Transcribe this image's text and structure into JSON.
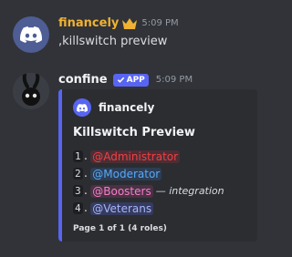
{
  "messages": [
    {
      "author": "financely",
      "author_color": "#f0b232",
      "badge_icon": "crown-icon",
      "time": "5:09 PM",
      "content": ",killswitch preview"
    },
    {
      "author": "confine",
      "author_color": "#f2f3f5",
      "app_badge": "APP",
      "time": "5:09 PM",
      "embed": {
        "accent_color": "#5865f2",
        "author_name": "financely",
        "title": "Killswitch Preview",
        "roles": [
          {
            "num": "1",
            "name": "@Administrator",
            "color": "#f23f43",
            "bg": "#4b2e35",
            "note": ""
          },
          {
            "num": "2",
            "name": "@Moderator",
            "color": "#5aa9f5",
            "bg": "#2c3d55",
            "note": ""
          },
          {
            "num": "3",
            "name": "@Boosters",
            "color": "#f47fc4",
            "bg": "#4a3145",
            "note": "— integration"
          },
          {
            "num": "4",
            "name": "@Veterans",
            "color": "#a7b5ff",
            "bg": "#353b5e",
            "note": ""
          }
        ],
        "footer": "Page 1 of 1 (4 roles)"
      }
    }
  ]
}
